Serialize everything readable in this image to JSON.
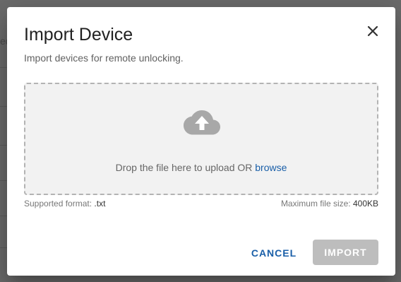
{
  "background": {
    "partial_text": "ed"
  },
  "dialog": {
    "title": "Import Device",
    "subtitle": "Import devices for remote unlocking.",
    "close_icon": "close-icon"
  },
  "dropzone": {
    "icon": "cloud-upload-icon",
    "text": "Drop the file here to upload OR ",
    "browse_label": "browse"
  },
  "format": {
    "label": "Supported format:",
    "value": ".txt"
  },
  "max_size": {
    "label": "Maximum file size:",
    "value": "400KB"
  },
  "actions": {
    "cancel_label": "CANCEL",
    "import_label": "IMPORT"
  },
  "colors": {
    "accent": "#1a5fa8",
    "disabled_button": "#bdbdbd",
    "dropzone_bg": "#f2f2f2"
  }
}
